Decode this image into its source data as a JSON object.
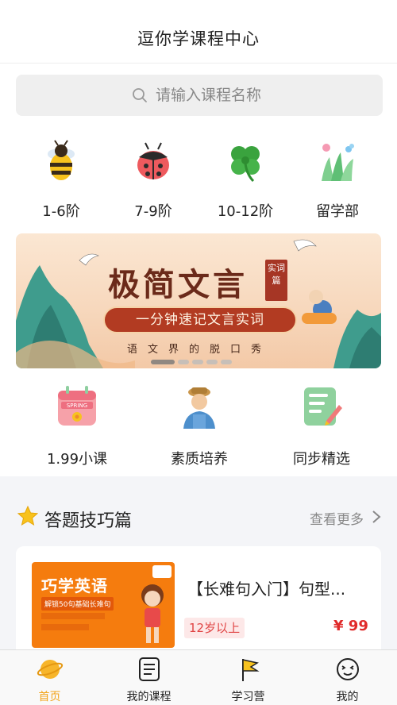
{
  "header": {
    "title": "逗你学课程中心"
  },
  "search": {
    "placeholder": "请输入课程名称"
  },
  "categories": [
    {
      "label": "1-6阶",
      "icon": "bee-icon"
    },
    {
      "label": "7-9阶",
      "icon": "ladybug-icon"
    },
    {
      "label": "10-12阶",
      "icon": "clover-icon"
    },
    {
      "label": "留学部",
      "icon": "grass-flower-icon"
    }
  ],
  "banner": {
    "title": "极简文言",
    "seal": "实词篇",
    "ribbon": "一分钟速记文言实词",
    "subtitle": "语文界的脱口秀",
    "slide_count": 5,
    "active_slide": 1
  },
  "features": [
    {
      "label": "1.99小课",
      "icon": "spring-calendar-icon"
    },
    {
      "label": "素质培养",
      "icon": "farmer-avatar-icon"
    },
    {
      "label": "同步精选",
      "icon": "notebook-pencil-icon"
    }
  ],
  "section": {
    "title": "答题技巧篇",
    "more": "查看更多"
  },
  "course_card": {
    "thumbnail_title": "巧学英语",
    "thumbnail_tag": "解锁50句基础长难句",
    "title": "【长难句入门】句型...",
    "age": "12岁以上",
    "price": "¥ 99"
  },
  "tabs": [
    {
      "label": "首页",
      "icon": "home-planet-icon",
      "active": true
    },
    {
      "label": "我的课程",
      "icon": "course-list-icon",
      "active": false
    },
    {
      "label": "学习营",
      "icon": "flag-icon",
      "active": false
    },
    {
      "label": "我的",
      "icon": "smiley-face-icon",
      "active": false
    }
  ],
  "colors": {
    "accent": "#f2a41a",
    "price": "#e02a2a",
    "banner_red": "#b23b22"
  }
}
